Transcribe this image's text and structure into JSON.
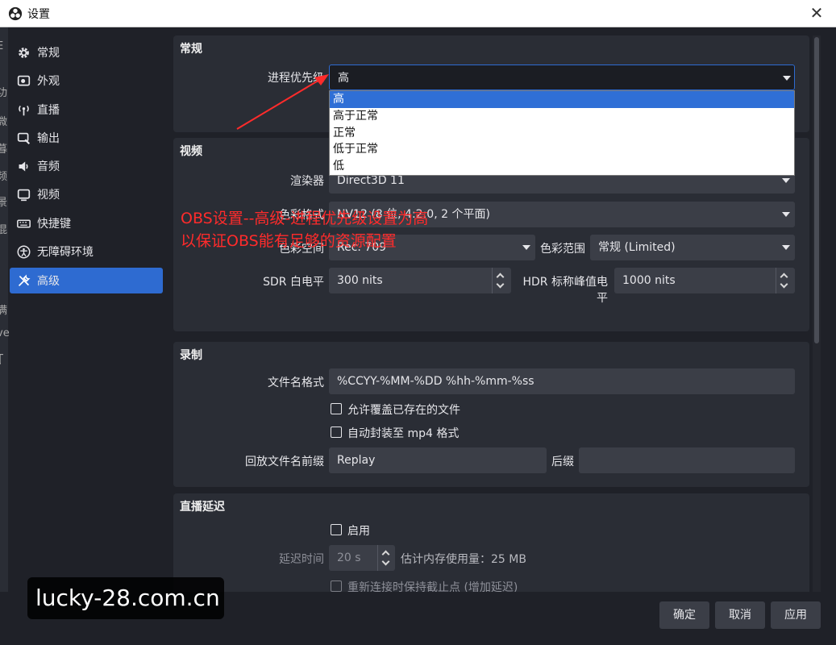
{
  "window": {
    "title": "设置",
    "close": "✕"
  },
  "left_strip": [
    "E",
    "功",
    "微",
    "暮",
    "频",
    "景",
    "混",
    "(",
    "满",
    "ve",
    "Ţ"
  ],
  "sidebar": {
    "items": [
      {
        "label": "常规",
        "icon": "gear-icon"
      },
      {
        "label": "外观",
        "icon": "appearance-icon"
      },
      {
        "label": "直播",
        "icon": "stream-icon"
      },
      {
        "label": "输出",
        "icon": "output-icon"
      },
      {
        "label": "音频",
        "icon": "audio-icon"
      },
      {
        "label": "视频",
        "icon": "video-icon"
      },
      {
        "label": "快捷键",
        "icon": "keyboard-icon"
      },
      {
        "label": "无障碍环境",
        "icon": "accessibility-icon"
      },
      {
        "label": "高级",
        "icon": "tools-icon"
      }
    ],
    "active": "高级"
  },
  "general": {
    "title": "常规",
    "priority_label": "进程优先级",
    "priority_value": "高",
    "priority_options": [
      "高",
      "高于正常",
      "正常",
      "低于正常",
      "低"
    ]
  },
  "video": {
    "title": "视频",
    "renderer_label": "渲染器",
    "renderer_value": "Direct3D 11",
    "color_format_label": "色彩格式",
    "color_format_value": "NV12 (8 位, 4:2:0, 2 个平面)",
    "color_space_label": "色彩空间",
    "color_space_value": "Rec. 709",
    "color_range_label": "色彩范围",
    "color_range_value": "常规 (Limited)",
    "sdr_label": "SDR 白电平",
    "sdr_value": "300 nits",
    "hdr_label": "HDR 标称峰值电平",
    "hdr_value": "1000 nits"
  },
  "recording": {
    "title": "录制",
    "filename_label": "文件名格式",
    "filename_value": "%CCYY-%MM-%DD %hh-%mm-%ss",
    "overwrite_label": "允许覆盖已存在的文件",
    "automux_label": "自动封装至 mp4 格式",
    "replay_prefix_label": "回放文件名前缀",
    "replay_prefix_value": "Replay",
    "suffix_label": "后缀",
    "suffix_value": ""
  },
  "stream_delay": {
    "title": "直播延迟",
    "enable_label": "启用",
    "delay_label": "延迟时间",
    "delay_value": "20 s",
    "memory_estimate": "估计内存使用量：25 MB",
    "preserve_label": "重新连接时保持截止点 (增加延迟)"
  },
  "annotation": {
    "line1": "OBS设置--高级-进程优先级设置为高",
    "line2": "以保证OBS能有足够的资源配置"
  },
  "buttons": {
    "ok": "确定",
    "cancel": "取消",
    "apply": "应用"
  },
  "watermark": "lucky-28.com.cn",
  "colors": {
    "accent": "#2e6bd1",
    "background": "#1f2128",
    "panel": "#2a2d35",
    "field": "#3b3e47",
    "annotation": "#ff2b2b"
  }
}
